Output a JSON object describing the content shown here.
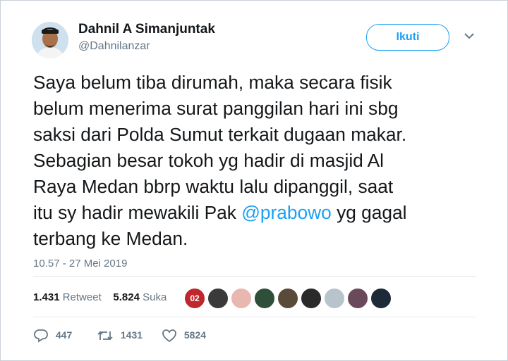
{
  "author": {
    "name": "Dahnil A Simanjuntak",
    "handle": "@Dahnilanzar"
  },
  "follow_label": "Ikuti",
  "tweet": {
    "lines": [
      "Saya belum tiba dirumah, maka secara fisik",
      "belum menerima surat panggilan hari ini sbg",
      "saksi dari Polda Sumut terkait dugaan makar.",
      "Sebagian besar tokoh yg hadir di masjid Al",
      "Raya Medan bbrp waktu lalu dipanggil, saat"
    ],
    "line6_before": "itu sy hadir mewakili Pak ",
    "mention": "@prabowo",
    "line6_after": " yg gagal",
    "line7": "terbang ke Medan."
  },
  "timestamp": "10.57 - 27 Mei 2019",
  "stats": {
    "retweets": "1.431",
    "retweet_label": "Retweet",
    "likes": "5.824",
    "like_label": "Suka"
  },
  "likers": {
    "first_badge": "02",
    "colors": [
      "#c0272d",
      "#3a3a3a",
      "#e8b8b0",
      "#2f4f3a",
      "#5a4a3a",
      "#2a2a2a",
      "#b8c4cc",
      "#6a4a5a",
      "#1e2a38"
    ]
  },
  "actions": {
    "reply_count": "447",
    "retweet_count": "1431",
    "like_count": "5824"
  },
  "colors": {
    "accent": "#1da1f2",
    "secondary_text": "#657786"
  }
}
